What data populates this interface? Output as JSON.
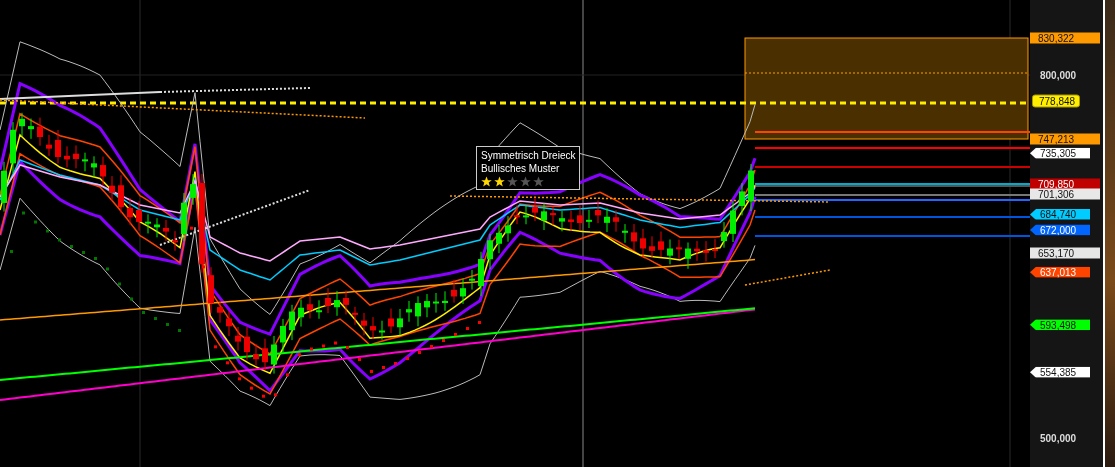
{
  "chart": {
    "annotation": {
      "title": "Symmetrisch Dreieck",
      "subtitle": "Bullisches Muster",
      "stars": 2
    }
  },
  "price_axis": {
    "ticks": [
      "800,000",
      "500,000"
    ],
    "tags": [
      {
        "label": "830,322",
        "kind": "box",
        "color": "#ff9900"
      },
      {
        "label": "778,848",
        "kind": "pill",
        "color": "#ffee00"
      },
      {
        "label": "747,213",
        "kind": "box",
        "color": "#ff9900"
      },
      {
        "label": "735,305",
        "kind": "flag",
        "color": "#ffffff"
      },
      {
        "label": "709,850",
        "kind": "box",
        "color": "#c00000"
      },
      {
        "label": "701,306",
        "kind": "box",
        "color": "#e8e8e8"
      },
      {
        "label": "684,740",
        "kind": "flag",
        "color": "#00ccff"
      },
      {
        "label": "672,000",
        "kind": "flag",
        "color": "#0066ff"
      },
      {
        "label": "653,170",
        "kind": "box",
        "color": "#e6e6e6"
      },
      {
        "label": "637,013",
        "kind": "flag",
        "color": "#ff4400"
      },
      {
        "label": "593,498",
        "kind": "flag",
        "color": "#00ff00"
      },
      {
        "label": "554,385",
        "kind": "flag",
        "color": "#ffffff"
      }
    ]
  }
}
